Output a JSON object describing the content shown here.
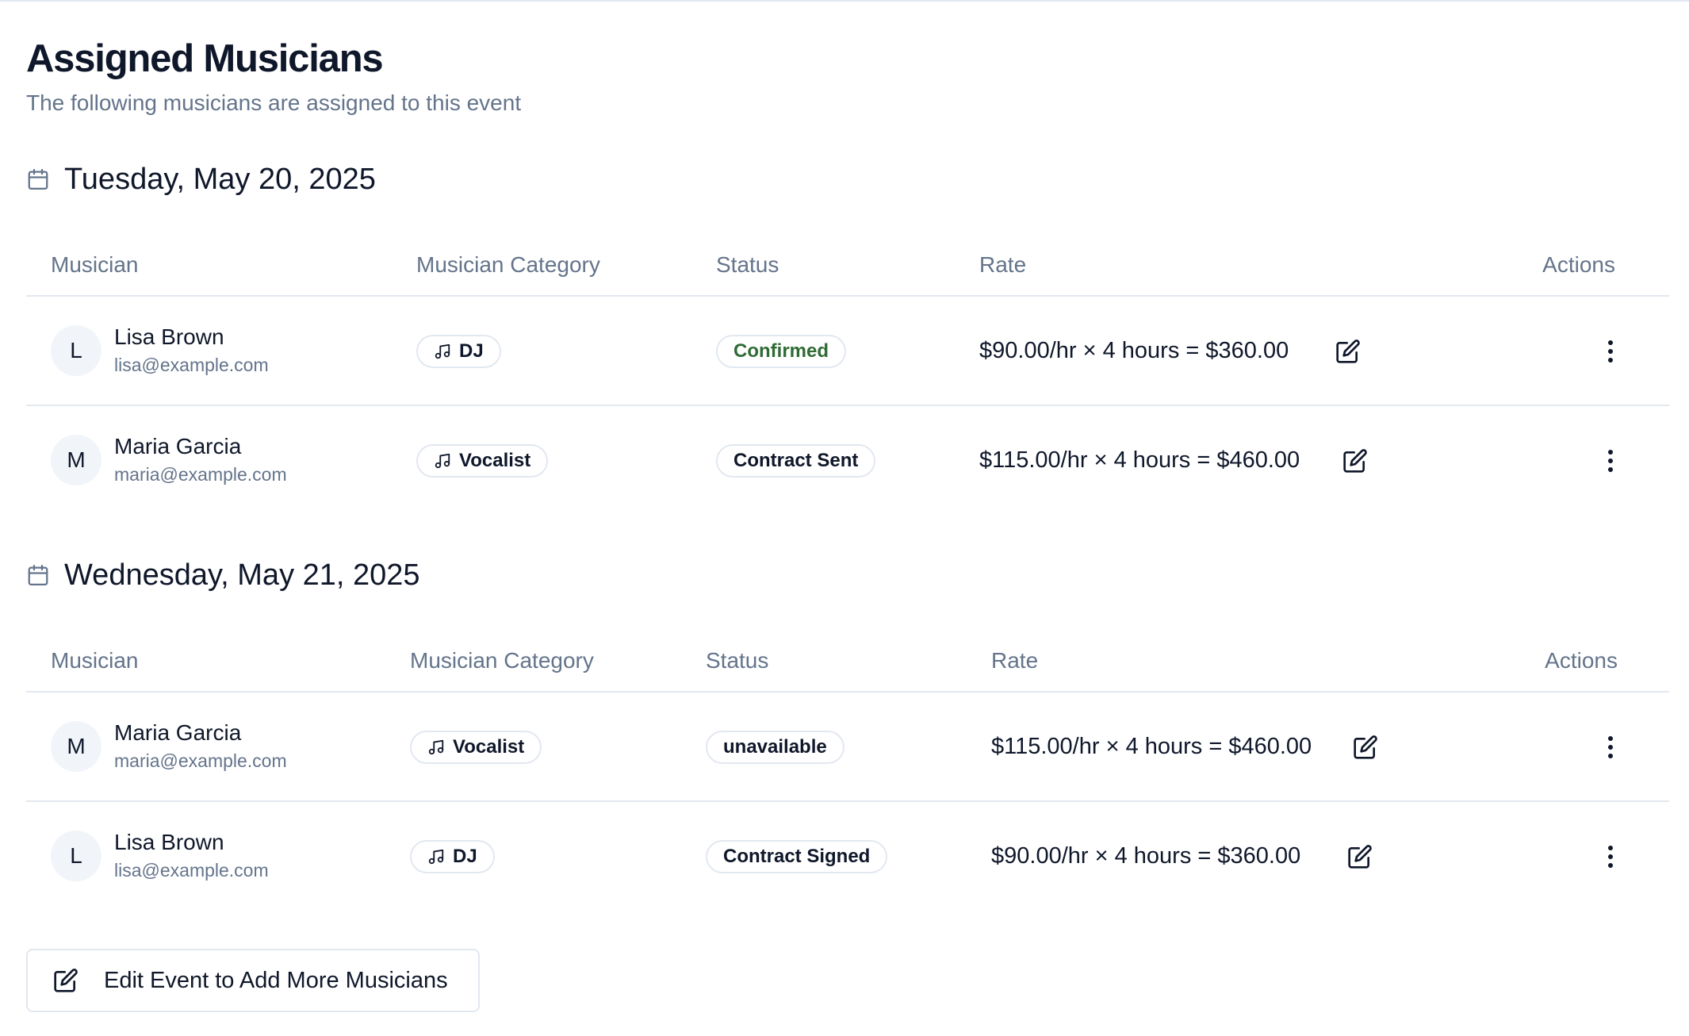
{
  "header": {
    "title": "Assigned Musicians",
    "subtitle": "The following musicians are assigned to this event"
  },
  "columns": {
    "musician": "Musician",
    "category": "Musician Category",
    "status": "Status",
    "rate": "Rate",
    "actions": "Actions"
  },
  "days": [
    {
      "date": "Tuesday, May 20, 2025",
      "rows": [
        {
          "initial": "L",
          "name": "Lisa Brown",
          "email": "lisa@example.com",
          "category": "DJ",
          "status": "Confirmed",
          "rate": "$90.00/hr × 4 hours = $360.00"
        },
        {
          "initial": "M",
          "name": "Maria Garcia",
          "email": "maria@example.com",
          "category": "Vocalist",
          "status": "Contract Sent",
          "rate": "$115.00/hr × 4 hours = $460.00"
        }
      ]
    },
    {
      "date": "Wednesday, May 21, 2025",
      "rows": [
        {
          "initial": "M",
          "name": "Maria Garcia",
          "email": "maria@example.com",
          "category": "Vocalist",
          "status": "unavailable",
          "rate": "$115.00/hr × 4 hours = $460.00"
        },
        {
          "initial": "L",
          "name": "Lisa Brown",
          "email": "lisa@example.com",
          "category": "DJ",
          "status": "Contract Signed",
          "rate": "$90.00/hr × 4 hours = $360.00"
        }
      ]
    }
  ],
  "footer": {
    "button_label": "Edit Event to Add More Musicians"
  },
  "icons": {
    "date": "calendar-icon",
    "category": "music-note-icon",
    "edit": "edit-pencil-icon",
    "row_menu": "more-vertical-icon"
  },
  "colors": {
    "text": "#0f172a",
    "muted": "#64748b",
    "border": "#e2e8f0",
    "avatar_bg": "#f1f5f9",
    "confirmed": "#2f6b34"
  }
}
